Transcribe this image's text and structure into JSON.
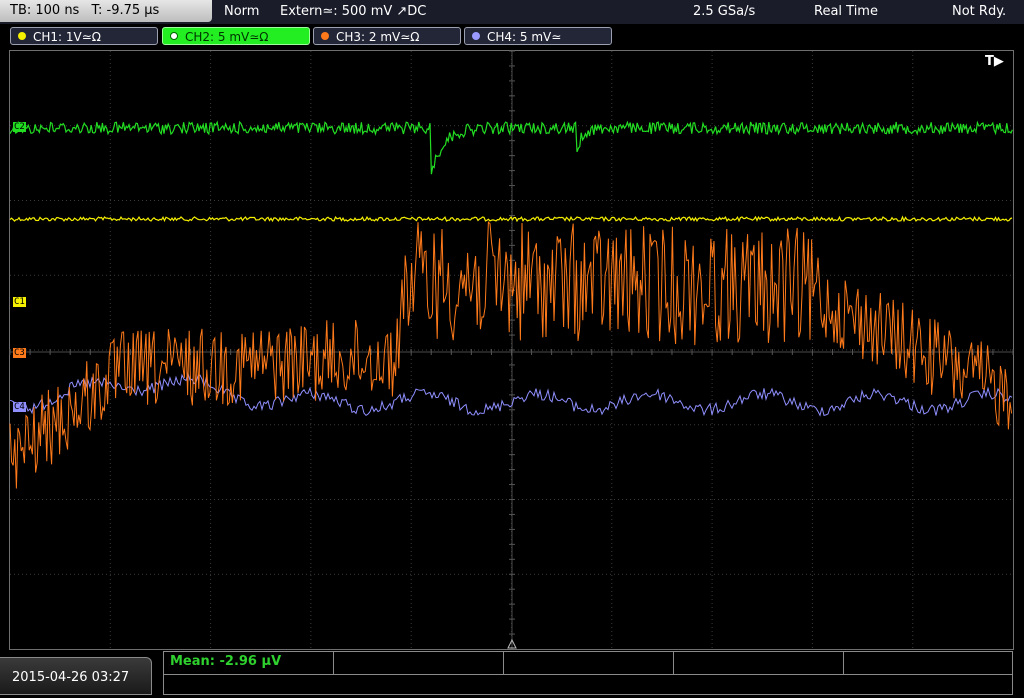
{
  "topbar": {
    "timebase": "TB: 100 ns",
    "trigger_time": "T: -9.75 µs",
    "mode": "Norm",
    "trigger_source": "Extern≃: 500 mV ↗DC",
    "sample_rate": "2.5 GSa/s",
    "acq_mode": "Real Time",
    "status": "Not Rdy."
  },
  "channels": [
    {
      "label": "CH1: 1V≃Ω",
      "color": "#f5f000"
    },
    {
      "label": "CH2: 5 mV≃Ω",
      "color": "#22ee22"
    },
    {
      "label": "CH3: 2 mV≃Ω",
      "color": "#ff7a1a"
    },
    {
      "label": "CH4: 5 mV≃",
      "color": "#9a9aff"
    }
  ],
  "markers": {
    "c1": "C1",
    "c3": "C3",
    "c4": "C4",
    "c2": "C2",
    "trigger": "T▶"
  },
  "bottom": {
    "date": "2015-04-26 03:27",
    "mean": "Mean: -2.96 µV"
  },
  "colors": {
    "grid": "#3a3a3a",
    "ch1": "#f5f000",
    "ch2": "#22dd22",
    "ch3": "#ff7a1a",
    "ch4": "#8f8fff"
  }
}
